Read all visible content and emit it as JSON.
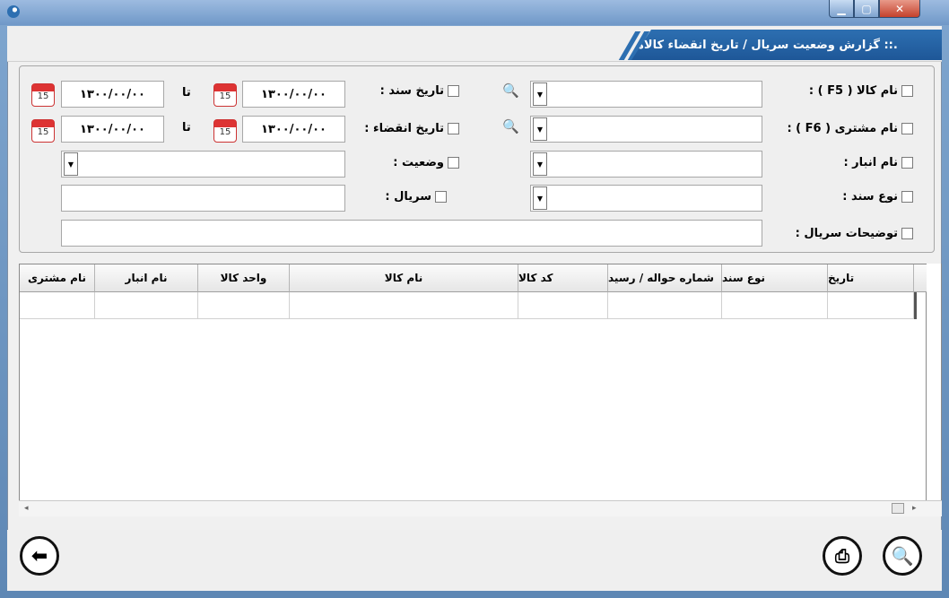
{
  "window": {
    "title": ".:: گزارش وضعیت سریال / تاریخ انقضاء کالاها"
  },
  "filters": {
    "product_name_label": "نام کالا ( F5 ) :",
    "customer_name_label": "نام مشتری ( F6 ) :",
    "warehouse_label": "نام انبار :",
    "doc_type_label": "نوع سند :",
    "serial_desc_label": "توضیحات سریال :",
    "doc_date_label": "تاریخ سند :",
    "expiry_date_label": "تاریخ انقضاء :",
    "status_label": "وضعیت :",
    "serial_label": "سریال :",
    "to_label": "تا",
    "doc_date_from": "۱۳۰۰/۰۰/۰۰",
    "doc_date_to": "۱۳۰۰/۰۰/۰۰",
    "expiry_date_from": "۱۳۰۰/۰۰/۰۰",
    "expiry_date_to": "۱۳۰۰/۰۰/۰۰",
    "calendar_day": "15"
  },
  "table": {
    "columns": [
      "تاریخ",
      "نوع سند",
      "شماره حواله / رسید",
      "کد کالا",
      "نام کالا",
      "واحد کالا",
      "نام انبار",
      "نام مشتری"
    ]
  },
  "icons": {
    "search": "search-icon",
    "calendar": "calendar-icon",
    "back": "back-arrow-icon",
    "print": "print-icon",
    "zoom": "magnifier-icon"
  },
  "colors": {
    "banner": "#2d6fb1",
    "window_frame": "#6f98c8",
    "close_button": "#c4412c"
  }
}
